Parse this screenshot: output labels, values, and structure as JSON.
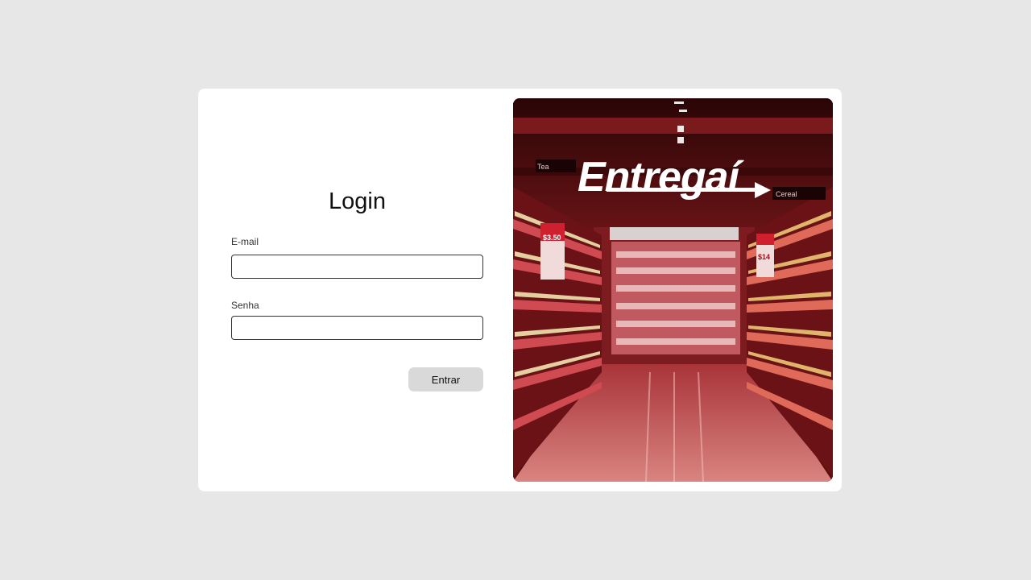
{
  "login": {
    "title": "Login",
    "email_label": "E-mail",
    "email_value": "",
    "password_label": "Senha",
    "password_value": "",
    "submit_label": "Entrar"
  },
  "hero": {
    "brand": "Entregaí",
    "aisle_signs": [
      "Tea",
      "Cereal"
    ],
    "price_tags": [
      "$3.50",
      "$14"
    ]
  },
  "colors": {
    "page_background": "#e7e7e7",
    "card_background": "#ffffff",
    "button_background": "#d9d9d9",
    "hero_tint": "#8b1a1e"
  }
}
